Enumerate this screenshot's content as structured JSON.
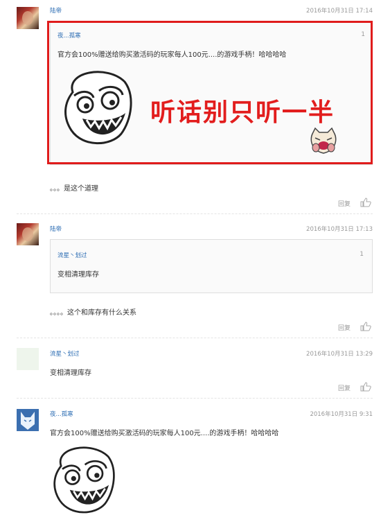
{
  "comments": [
    {
      "user": "陆帝",
      "time": "2016年10月31日 17:14",
      "quote": {
        "user": "夜...孤寒",
        "num": "1",
        "text": "官方会100%赠送给购买激活码的玩家每人100元....的游戏手柄！哈哈哈哈",
        "meme_caption": "听话别只听一半"
      },
      "text": "。。。是这个道理",
      "reply_label": "回复"
    },
    {
      "user": "陆帝",
      "time": "2016年10月31日 17:13",
      "quote": {
        "user": "流星丶划过",
        "num": "1",
        "text": "变相清理库存"
      },
      "text": "。。。。这个和库存有什么关系",
      "reply_label": "回复"
    },
    {
      "user": "流星丶划过",
      "time": "2016年10月31日 13:29",
      "text": "变相清理库存",
      "reply_label": "回复"
    },
    {
      "user": "夜...孤寒",
      "time": "2016年10月31日 9:31",
      "text": "官方会100%赠送给购买激活码的玩家每人100元....的游戏手柄！哈哈哈哈"
    }
  ],
  "icons": {
    "like": "thumbs-up-icon",
    "meme": "rage-face-icon",
    "sticker": "laughing-cat-icon"
  },
  "colors": {
    "highlight_border": "#e01c1c",
    "caption": "#e21d1d",
    "username": "#2b6cb3"
  }
}
